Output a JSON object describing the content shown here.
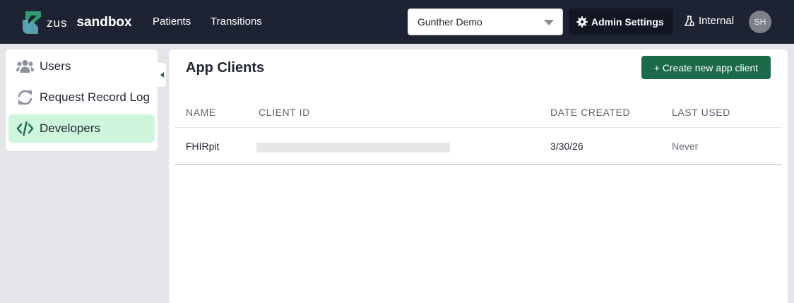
{
  "header": {
    "brand_mark": "zus",
    "brand_env": "sandbox",
    "nav": [
      {
        "label": "Patients"
      },
      {
        "label": "Transitions"
      }
    ],
    "org_select": {
      "value": "Gunther Demo"
    },
    "admin_settings_label": "Admin Settings",
    "internal_label": "Internal",
    "avatar_initials": "SH"
  },
  "sidebar": {
    "items": [
      {
        "label": "Users",
        "icon": "users-icon",
        "active": false
      },
      {
        "label": "Request Record Log",
        "icon": "refresh-icon",
        "active": false
      },
      {
        "label": "Developers",
        "icon": "code-icon",
        "active": true
      }
    ]
  },
  "main": {
    "title": "App Clients",
    "create_button_label": "+ Create new app client",
    "table": {
      "columns": [
        "NAME",
        "CLIENT ID",
        "DATE CREATED",
        "LAST USED"
      ],
      "rows": [
        {
          "name": "FHIRpit",
          "client_id": "",
          "date_created": "3/30/26",
          "last_used": "Never"
        }
      ]
    }
  },
  "colors": {
    "topbar": "#1e2333",
    "accent_green": "#1b6a48",
    "active_item_bg": "#cdf6dc",
    "background": "#e3e5e9"
  }
}
